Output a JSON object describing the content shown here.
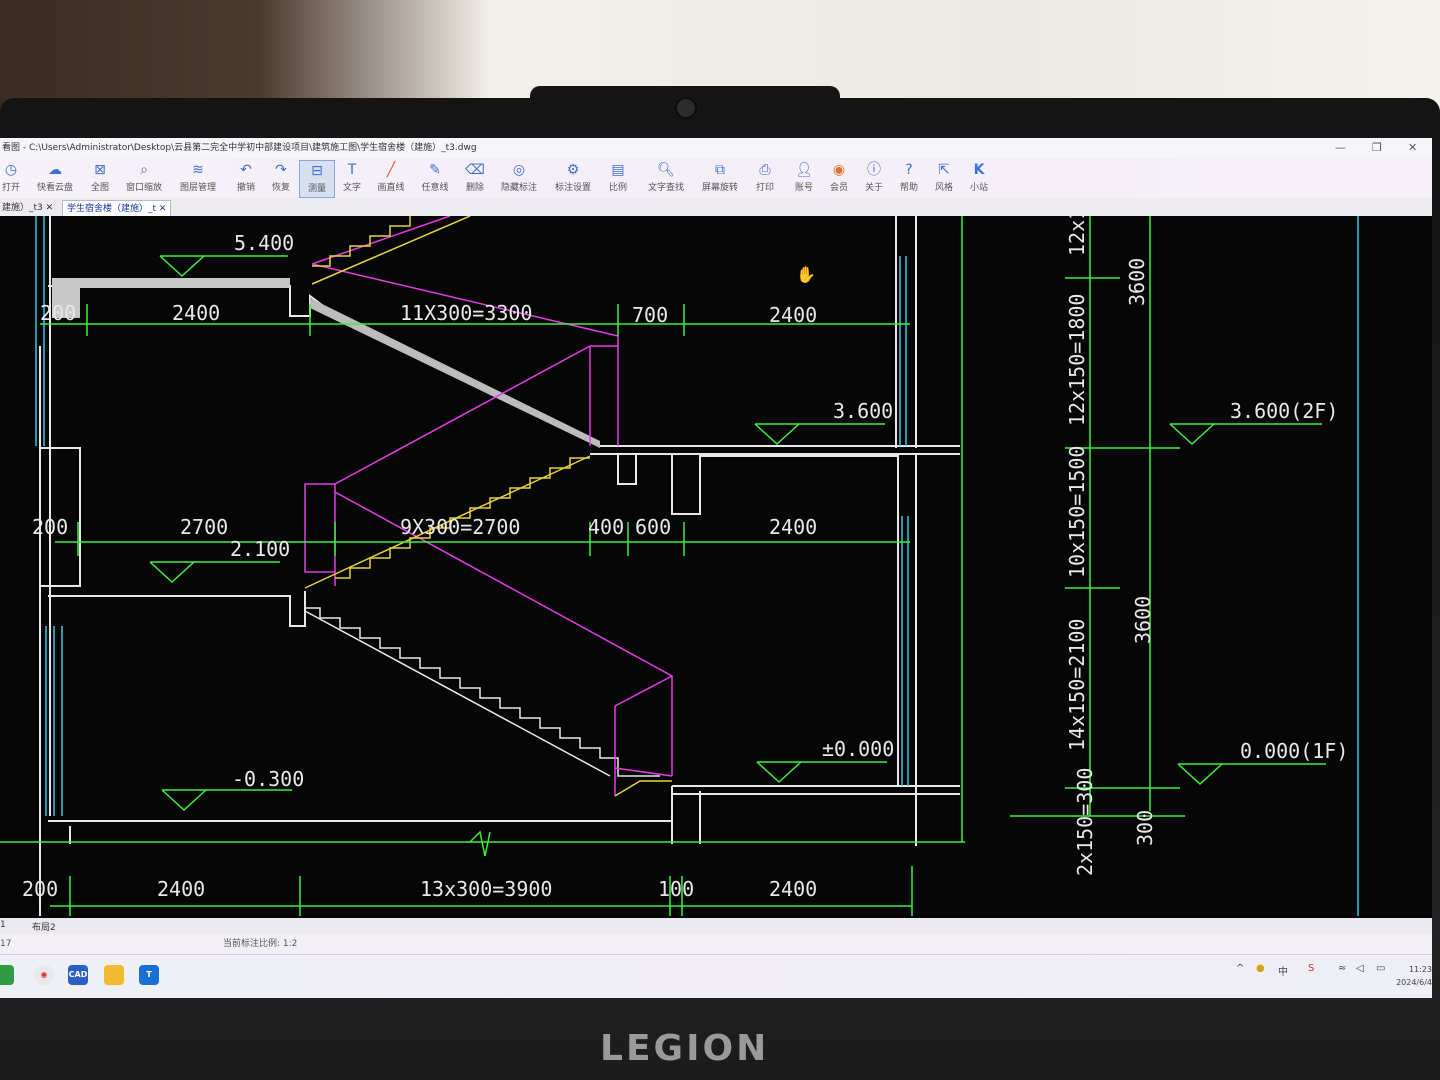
{
  "window": {
    "title": "看图 - C:\\Users\\Administrator\\Desktop\\云县第二完全中学初中部建设项目\\建筑施工图\\学生宿舍楼（建施）_t3.dwg"
  },
  "toolbar": [
    {
      "label": "打开",
      "icon": "open-icon"
    },
    {
      "label": "快看云盘",
      "icon": "cloud-icon"
    },
    {
      "label": "全图",
      "icon": "fit-all-icon"
    },
    {
      "label": "窗口缩放",
      "icon": "zoom-window-icon"
    },
    {
      "label": "图层管理",
      "icon": "layers-icon"
    },
    {
      "label": "撤销",
      "icon": "undo-icon"
    },
    {
      "label": "恢复",
      "icon": "redo-icon"
    },
    {
      "label": "测量",
      "icon": "measure-icon"
    },
    {
      "label": "文字",
      "icon": "text-icon"
    },
    {
      "label": "画直线",
      "icon": "line-icon"
    },
    {
      "label": "任意线",
      "icon": "freehand-icon"
    },
    {
      "label": "删除",
      "icon": "eraser-icon"
    },
    {
      "label": "隐藏标注",
      "icon": "hide-icon"
    },
    {
      "label": "标注设置",
      "icon": "annotation-settings-icon"
    },
    {
      "label": "比例",
      "icon": "scale-icon"
    },
    {
      "label": "文字查找",
      "icon": "find-text-icon"
    },
    {
      "label": "屏幕旋转",
      "icon": "rotate-icon"
    },
    {
      "label": "打印",
      "icon": "print-icon"
    },
    {
      "label": "账号",
      "icon": "user-icon"
    },
    {
      "label": "会员",
      "icon": "vip-icon"
    },
    {
      "label": "关于",
      "icon": "info-icon"
    },
    {
      "label": "帮助",
      "icon": "help-icon"
    },
    {
      "label": "风格",
      "icon": "style-icon"
    },
    {
      "label": "小站",
      "icon": "k-icon"
    }
  ],
  "tabs": [
    {
      "label": "建施）_t3"
    },
    {
      "label": "学生宿舍楼（建施）_t"
    }
  ],
  "drawing": {
    "elevations": {
      "e_5400": "5.400",
      "e_3600": "3.600",
      "e_2100": "2.100",
      "e_000": "±0.000",
      "e_m300": "-0.300",
      "e_2f": "3.600(2F)",
      "e_1f": "0.000(1F)"
    },
    "dims": {
      "top_200": "200",
      "top_2400a": "2400",
      "top_stair": "11X300=3300",
      "top_700": "700",
      "top_2400b": "2400",
      "mid_200": "200",
      "mid_2700": "2700",
      "mid_stair": "9X300=2700",
      "mid_400": "400",
      "mid_600": "600",
      "mid_2400": "2400",
      "bot_200": "200",
      "bot_2400a": "2400",
      "bot_stair": "13x300=3900",
      "bot_100": "100",
      "bot_2400b": "2400",
      "v_12x1": "12x1",
      "v_1800": "12x150=1800",
      "v_1500": "10x150=1500",
      "v_2100": "14x150=2100",
      "v_300": "2x150=300",
      "v_3600a": "3600",
      "v_3600b": "3600",
      "v_300b": "300"
    }
  },
  "layouts": {
    "tab1": "1",
    "tab2": "布局2"
  },
  "status": {
    "left": "17",
    "scale_text": "当前标注比例: 1:2"
  },
  "taskbar": {
    "clock_time": "11:23",
    "clock_date": "2024/6/4",
    "ime": "中"
  },
  "brand": "LEGION",
  "colors": {
    "dim": "#3cf03c",
    "stair": "#e63ce6",
    "riser": "#e6d23c",
    "wall": "#e8e8e8",
    "cyan": "#36c8e0"
  }
}
